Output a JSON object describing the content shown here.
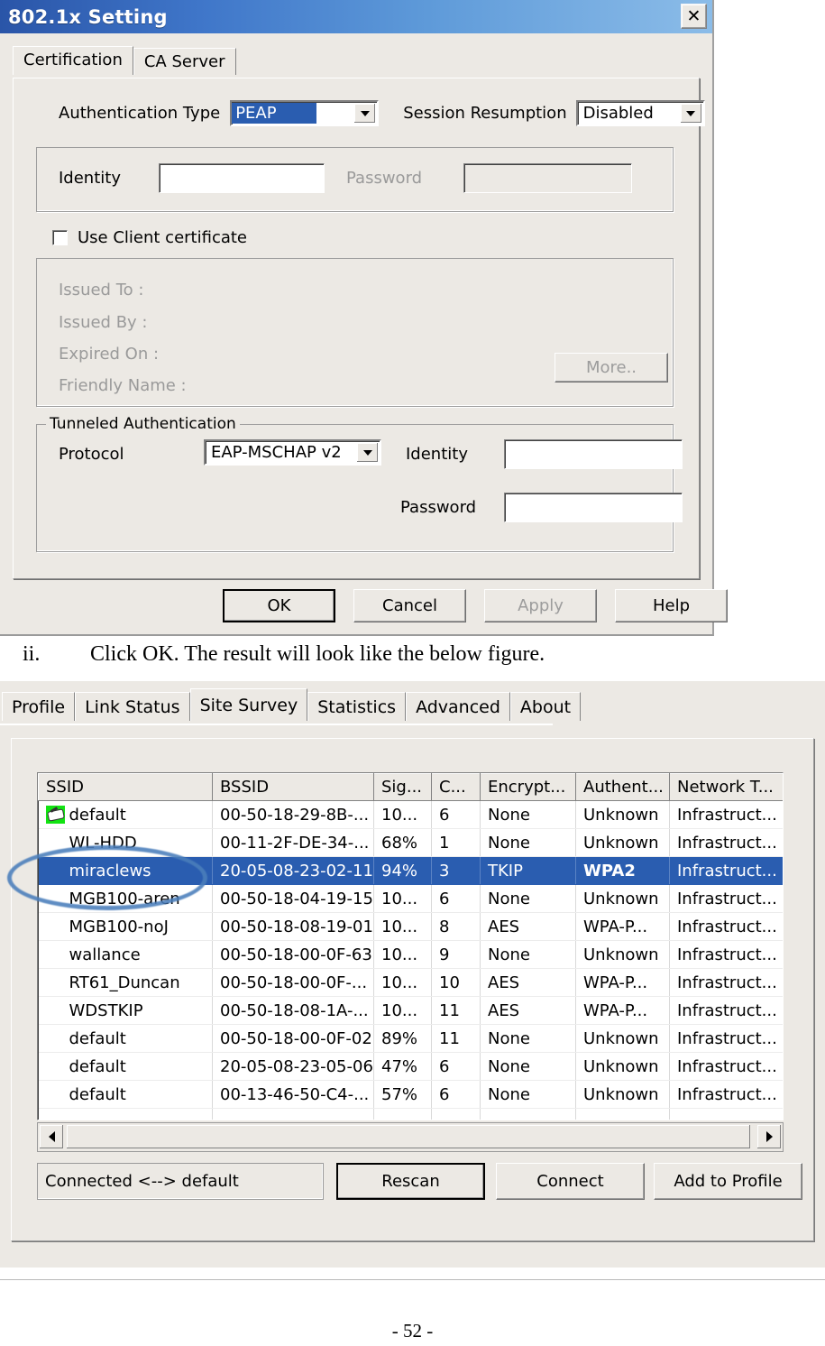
{
  "dialog": {
    "title": "802.1x Setting",
    "close_label": "✕",
    "tabs": [
      {
        "label": "Certification",
        "active": true
      },
      {
        "label": "CA Server",
        "active": false
      }
    ],
    "auth_type": {
      "label": "Authentication Type",
      "value": "PEAP"
    },
    "session_resumption": {
      "label": "Session Resumption",
      "value": "Disabled"
    },
    "identity": {
      "label": "Identity",
      "value": ""
    },
    "password": {
      "label": "Password",
      "value": ""
    },
    "use_client_certificate": {
      "label": "Use Client certificate",
      "checked": false
    },
    "certificate": {
      "issued_to_label": "Issued To :",
      "issued_by_label": "Issued By :",
      "expired_on_label": "Expired On :",
      "friendly_name_label": "Friendly Name :",
      "more_button": "More.."
    },
    "tunneled": {
      "group_label": "Tunneled Authentication",
      "protocol_label": "Protocol",
      "protocol_value": "EAP-MSCHAP v2",
      "identity_label": "Identity",
      "identity_value": "",
      "password_label": "Password",
      "password_value": ""
    },
    "buttons": {
      "ok": "OK",
      "cancel": "Cancel",
      "apply": "Apply",
      "help": "Help"
    }
  },
  "instruction": {
    "marker": "ii.",
    "text": "Click OK. The result will look like the below figure."
  },
  "utility": {
    "tabs": [
      {
        "label": "Profile",
        "active": false
      },
      {
        "label": "Link Status",
        "active": false
      },
      {
        "label": "Site Survey",
        "active": true
      },
      {
        "label": "Statistics",
        "active": false
      },
      {
        "label": "Advanced",
        "active": false
      },
      {
        "label": "About",
        "active": false
      }
    ],
    "table": {
      "headers": [
        "SSID",
        "BSSID",
        "Sig...",
        "C...",
        "Encrypt...",
        "Authent...",
        "Network T..."
      ],
      "rows": [
        {
          "icon": "connected-icon",
          "ssid": "default",
          "bssid": "00-50-18-29-8B-...",
          "signal": "10...",
          "channel": "6",
          "encryption": "None",
          "authentication": "Unknown",
          "network_type": "Infrastruct...",
          "selected": false
        },
        {
          "icon": "",
          "ssid": "WL-HDD",
          "bssid": "00-11-2F-DE-34-...",
          "signal": "68%",
          "channel": "1",
          "encryption": "None",
          "authentication": "Unknown",
          "network_type": "Infrastruct...",
          "selected": false
        },
        {
          "icon": "",
          "ssid": "miraclews",
          "bssid": "20-05-08-23-02-11",
          "signal": "94%",
          "channel": "3",
          "encryption": "TKIP",
          "authentication": "WPA2",
          "network_type": "Infrastruct...",
          "selected": true
        },
        {
          "icon": "",
          "ssid": "MGB100-aren",
          "bssid": "00-50-18-04-19-15",
          "signal": "10...",
          "channel": "6",
          "encryption": "None",
          "authentication": "Unknown",
          "network_type": "Infrastruct...",
          "selected": false
        },
        {
          "icon": "",
          "ssid": "MGB100-noJ",
          "bssid": "00-50-18-08-19-01",
          "signal": "10...",
          "channel": "8",
          "encryption": "AES",
          "authentication": "WPA-P...",
          "network_type": "Infrastruct...",
          "selected": false
        },
        {
          "icon": "",
          "ssid": "wallance",
          "bssid": "00-50-18-00-0F-63",
          "signal": "10...",
          "channel": "9",
          "encryption": "None",
          "authentication": "Unknown",
          "network_type": "Infrastruct...",
          "selected": false
        },
        {
          "icon": "",
          "ssid": "RT61_Duncan",
          "bssid": "00-50-18-00-0F-...",
          "signal": "10...",
          "channel": "10",
          "encryption": "AES",
          "authentication": "WPA-P...",
          "network_type": "Infrastruct...",
          "selected": false
        },
        {
          "icon": "",
          "ssid": "WDSTKIP",
          "bssid": "00-50-18-08-1A-...",
          "signal": "10...",
          "channel": "11",
          "encryption": "AES",
          "authentication": "WPA-P...",
          "network_type": "Infrastruct...",
          "selected": false
        },
        {
          "icon": "",
          "ssid": "default",
          "bssid": "00-50-18-00-0F-02",
          "signal": "89%",
          "channel": "11",
          "encryption": "None",
          "authentication": "Unknown",
          "network_type": "Infrastruct...",
          "selected": false
        },
        {
          "icon": "",
          "ssid": "default",
          "bssid": "20-05-08-23-05-06",
          "signal": "47%",
          "channel": "6",
          "encryption": "None",
          "authentication": "Unknown",
          "network_type": "Infrastruct...",
          "selected": false
        },
        {
          "icon": "",
          "ssid": "default",
          "bssid": "00-13-46-50-C4-...",
          "signal": "57%",
          "channel": "6",
          "encryption": "None",
          "authentication": "Unknown",
          "network_type": "Infrastruct...",
          "selected": false
        }
      ]
    },
    "status_text": "Connected <--> default",
    "buttons": {
      "rescan": "Rescan",
      "connect": "Connect",
      "add_to_profile": "Add to Profile"
    }
  },
  "page": {
    "number": "- 52 -"
  },
  "colors": {
    "titlebar_start": "#2a55a8",
    "titlebar_end": "#8bbce8",
    "selection_blue": "#2a5db0",
    "face": "#ece9e4",
    "annotation_blue": "#4a7ebb",
    "connected_icon_green": "#12e312"
  }
}
